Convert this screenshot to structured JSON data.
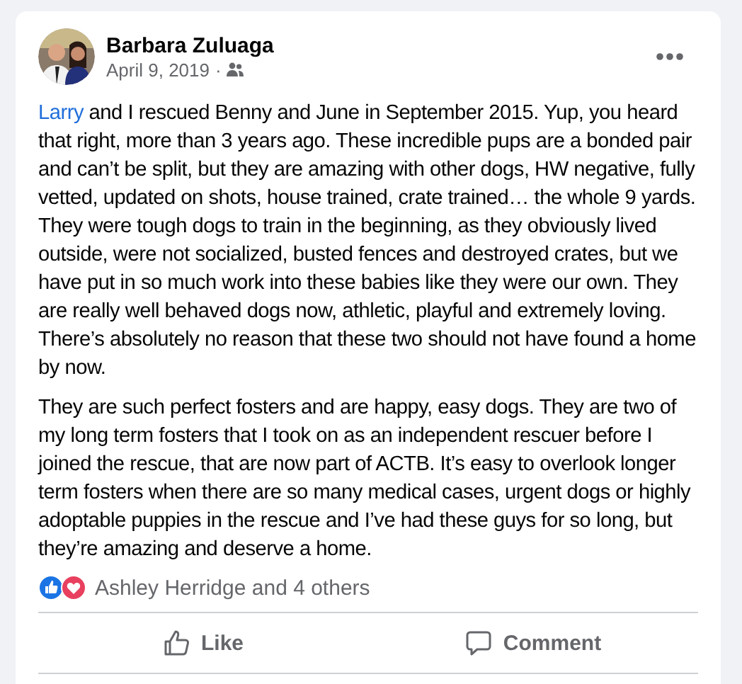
{
  "post": {
    "author": "Barbara Zuluaga",
    "date": "April 9, 2019",
    "separator": "·",
    "paragraphs": [
      {
        "link": "Larry",
        "text": " and I rescued Benny and June in September 2015. Yup, you heard that right, more than 3 years ago. These incredible pups are a bonded pair and can’t be split, but they are amazing with other dogs, HW negative, fully vetted, updated on shots, house trained, crate trained… the whole 9 yards. They were tough dogs to train in the beginning, as they obviously lived outside, were not socialized, busted fences and destroyed crates, but we have put in so much work into these babies like they were our own. They are really well behaved dogs now, athletic, playful and extremely loving. There’s absolutely no reason that these two should not have found a home by now."
      },
      {
        "text": "They are such perfect fosters and are happy, easy dogs. They are two of my long term fosters that I took on as an independent rescuer before I joined the rescue, that are now part of ACTB. It’s easy to overlook longer term fosters when there are so many medical cases, urgent dogs or highly adoptable puppies in the rescue and I’ve had these guys for so long, but they’re amazing and deserve a home."
      }
    ],
    "reactions": {
      "summary": "Ashley Herridge and 4 others"
    },
    "actions": [
      {
        "kind": "like",
        "label": "Like"
      },
      {
        "kind": "comment",
        "label": "Comment"
      }
    ]
  }
}
